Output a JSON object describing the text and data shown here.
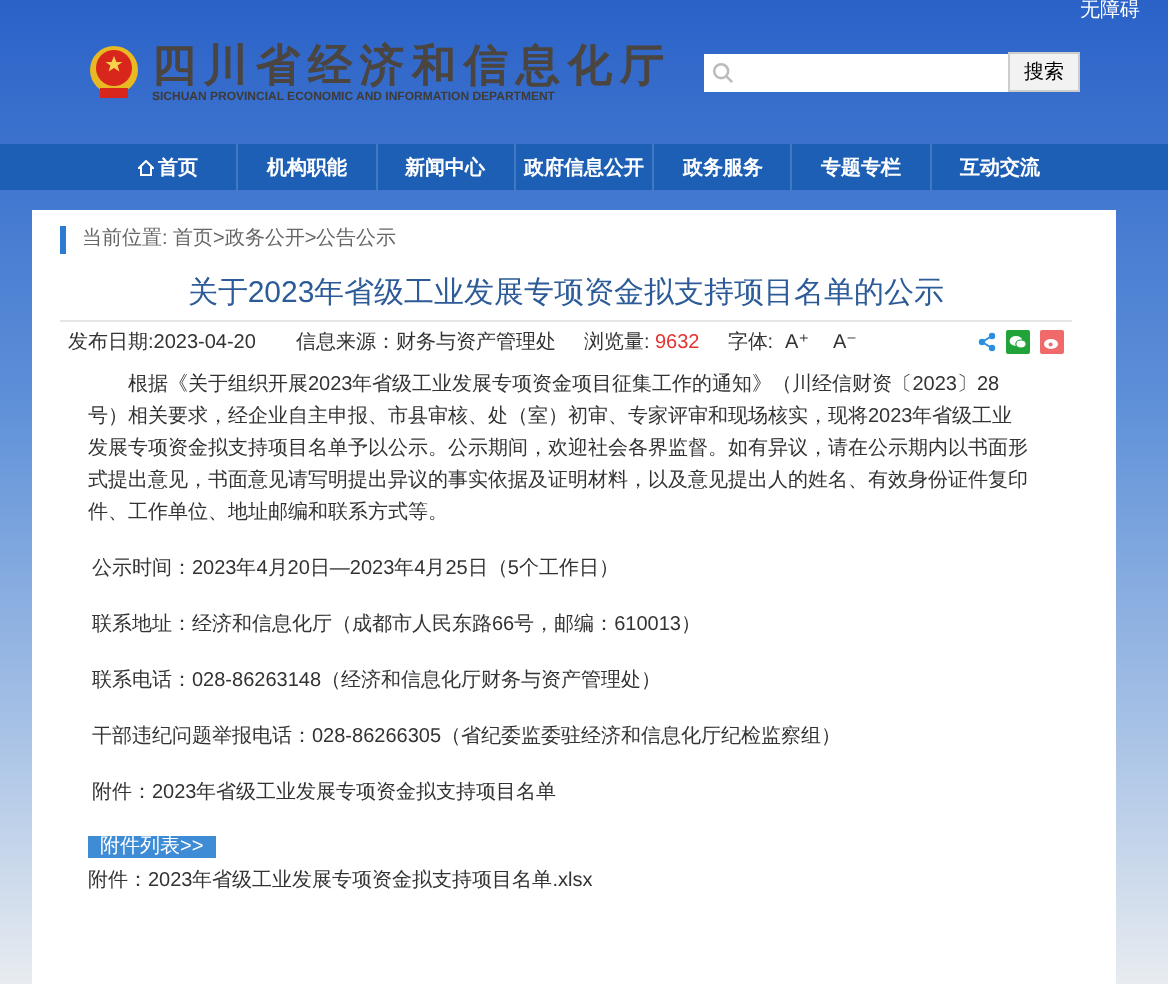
{
  "header": {
    "top_link": "无障碍",
    "site_name": "四川省经济和信息化厅",
    "site_name_en": "SICHUAN PROVINCIAL ECONOMIC AND INFORMATION DEPARTMENT",
    "search": {
      "button": "搜索"
    }
  },
  "nav": [
    {
      "label": "首页",
      "kind": "home"
    },
    {
      "label": "机构职能",
      "kind": "plain"
    },
    {
      "label": "新闻中心",
      "kind": "plain"
    },
    {
      "label": "政府信息公开",
      "kind": "plain"
    },
    {
      "label": "政务服务",
      "kind": "plain"
    },
    {
      "label": "专题专栏",
      "kind": "plain"
    },
    {
      "label": "互动交流",
      "kind": "plain"
    }
  ],
  "article": {
    "breadcrumb": "当前位置: 首页>政务公开>公告公示",
    "title": "关于2023年省级工业发展专项资金拟支持项目名单的公示",
    "meta": {
      "date": "发布日期:2023-04-20",
      "source": "信息来源：财务与资产管理处",
      "views_label": "浏览量:",
      "views": "9632",
      "font_label": "字体:",
      "font_up": "A⁺",
      "font_down": "A⁻"
    },
    "paragraphs": [
      "根据《关于组织开展2023年省级工业发展专项资金项目征集工作的通知》（川经信财资〔2023〕28号）相关要求，经企业自主申报、市县审核、处（室）初审、专家评审和现场核实，现将2023年省级工业发展专项资金拟支持项目名单予以公示。公示期间，欢迎社会各界监督。如有异议，请在公示期内以书面形式提出意见，书面意见请写明提出异议的事实依据及证明材料，以及意见提出人的姓名、有效身份证件复印件、工作单位、地址邮编和联系方式等。",
      "公示时间：2023年4月20日—2023年4月25日（5个工作日）",
      "联系地址：经济和信息化厅（成都市人民东路66号，邮编：610013）",
      "联系电话：028-86263148（经济和信息化厅财务与资产管理处）",
      "干部违纪问题举报电话：028-86266305（省纪委监委驻经济和信息化厅纪检监察组）",
      "附件：2023年省级工业发展专项资金拟支持项目名单"
    ],
    "attachments_label": "附件列表>>",
    "attachments": [
      "附件：2023年省级工业发展专项资金拟支持项目名单.xlsx"
    ]
  }
}
